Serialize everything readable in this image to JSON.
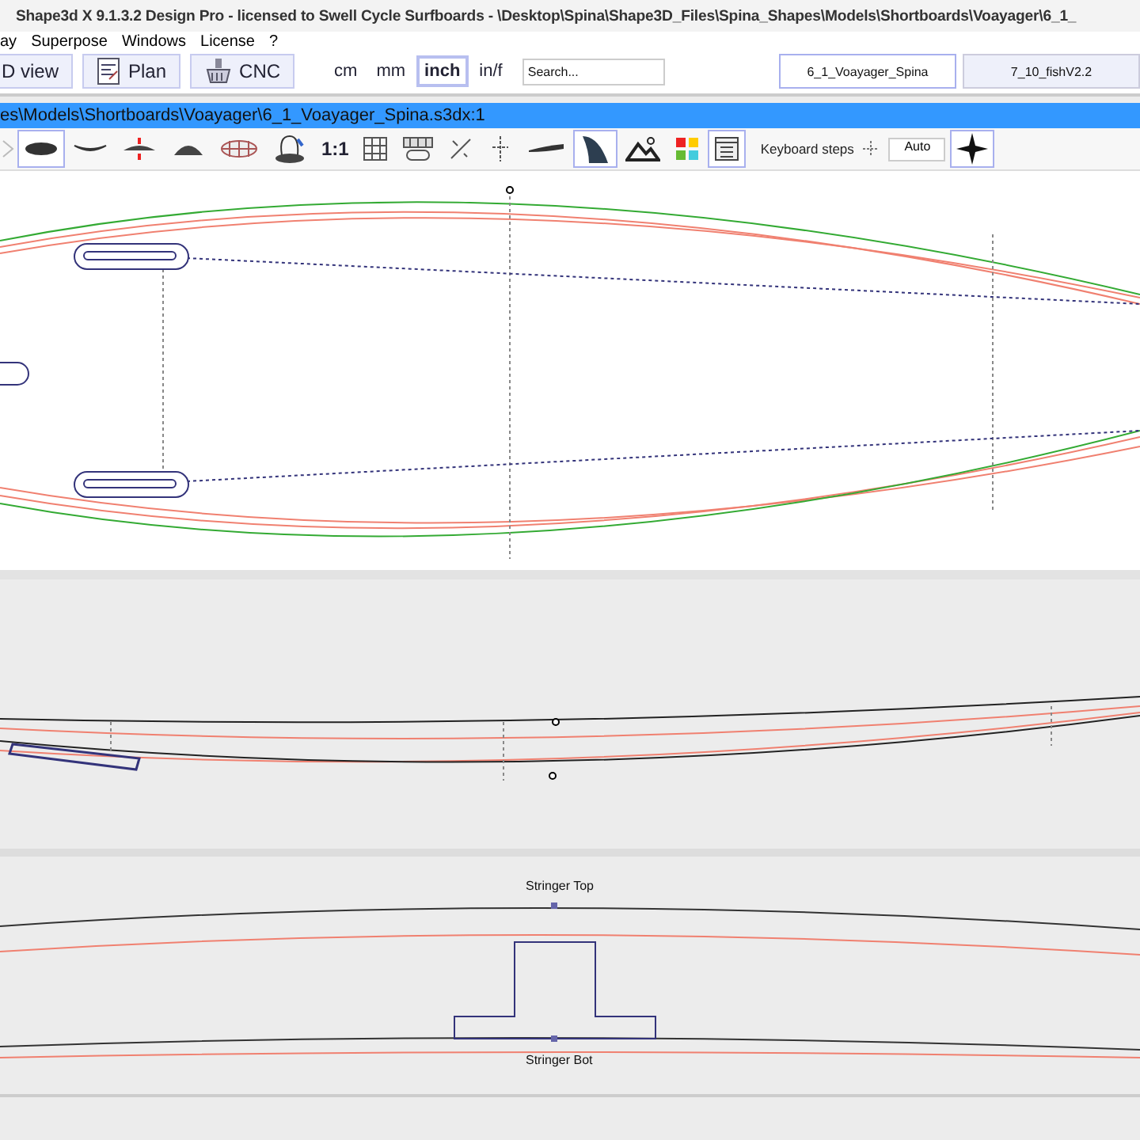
{
  "window": {
    "title": "Shape3d X 9.1.3.2 Design Pro - licensed to Swell Cycle Surfboards - \\Desktop\\Spina\\Shape3D_Files\\Spina_Shapes\\Models\\Shortboards\\Voayager\\6_1_"
  },
  "menu": [
    "ay",
    "Superpose",
    "Windows",
    "License",
    "?"
  ],
  "toolbar": {
    "buttons": [
      {
        "kind": "view3d",
        "label": "D view"
      },
      {
        "kind": "plan",
        "label": "Plan"
      },
      {
        "kind": "cnc",
        "label": "CNC"
      }
    ],
    "units": [
      {
        "label": "cm",
        "selected": false
      },
      {
        "label": "mm",
        "selected": false
      },
      {
        "label": "inch",
        "selected": true
      },
      {
        "label": "in/f",
        "selected": false
      }
    ],
    "search": {
      "placeholder": "Search..."
    }
  },
  "tabs": [
    {
      "label": "6_1_Voayager_Spina",
      "selected": true
    },
    {
      "label": "7_10_fishV2.2",
      "selected": false
    }
  ],
  "path_bar": "es\\Models\\Shortboards\\Voayager\\6_1_Voayager_Spina.s3dx:1",
  "tools": [
    {
      "kind": "outline",
      "selected": true
    },
    {
      "kind": "rocker",
      "selected": false
    },
    {
      "kind": "thickness",
      "selected": false
    },
    {
      "kind": "slice",
      "selected": false
    },
    {
      "kind": "grid-board",
      "selected": false
    },
    {
      "kind": "rotate",
      "selected": false
    },
    {
      "kind": "scale",
      "label": "1:1",
      "selected": false
    },
    {
      "kind": "grid",
      "selected": false
    },
    {
      "kind": "panel",
      "selected": false
    },
    {
      "kind": "diagonal",
      "selected": false
    },
    {
      "kind": "cross",
      "selected": false
    },
    {
      "kind": "side",
      "selected": false
    },
    {
      "kind": "fin",
      "selected": true
    },
    {
      "kind": "mountain",
      "selected": false
    },
    {
      "kind": "colors",
      "selected": false
    },
    {
      "kind": "list",
      "selected": true
    }
  ],
  "keyboard": {
    "label": "Keyboard steps",
    "value": "Auto"
  },
  "star_tool": {
    "selected": true
  },
  "stringer": {
    "top_label": "Stringer Top",
    "bottom_label": "Stringer Bot"
  }
}
